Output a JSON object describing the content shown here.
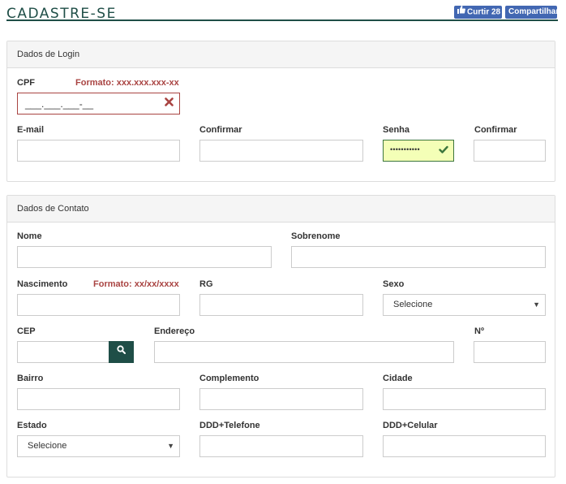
{
  "header": {
    "title": "CADASTRE-SE",
    "like_label": "Curtir 28",
    "share_label": "Compartilhar"
  },
  "login": {
    "section_title": "Dados de Login",
    "cpf_label": "CPF",
    "cpf_hint": "Formato: xxx.xxx.xxx-xx",
    "cpf_value": "___.___.___-__",
    "email_label": "E-mail",
    "confirm_email_label": "Confirmar",
    "senha_label": "Senha",
    "senha_value": "•••••••••••",
    "confirm_senha_label": "Confirmar"
  },
  "contact": {
    "section_title": "Dados de Contato",
    "nome_label": "Nome",
    "sobrenome_label": "Sobrenome",
    "nascimento_label": "Nascimento",
    "nascimento_hint": "Formato: xx/xx/xxxx",
    "rg_label": "RG",
    "sexo_label": "Sexo",
    "sexo_value": "Selecione",
    "cep_label": "CEP",
    "endereco_label": "Endereço",
    "numero_label": "Nº",
    "bairro_label": "Bairro",
    "complemento_label": "Complemento",
    "cidade_label": "Cidade",
    "estado_label": "Estado",
    "estado_value": "Selecione",
    "telefone_label": "DDD+Telefone",
    "celular_label": "DDD+Celular"
  },
  "icons": {
    "like": "thumbs-up-icon",
    "error": "times-icon",
    "valid": "check-icon",
    "search": "search-icon",
    "dropdown": "caret-down-icon"
  },
  "colors": {
    "brand": "#1f4e47",
    "facebook": "#4267b2",
    "error": "#a94442",
    "success": "#3c763d",
    "success_bg": "#f4ffb7"
  }
}
